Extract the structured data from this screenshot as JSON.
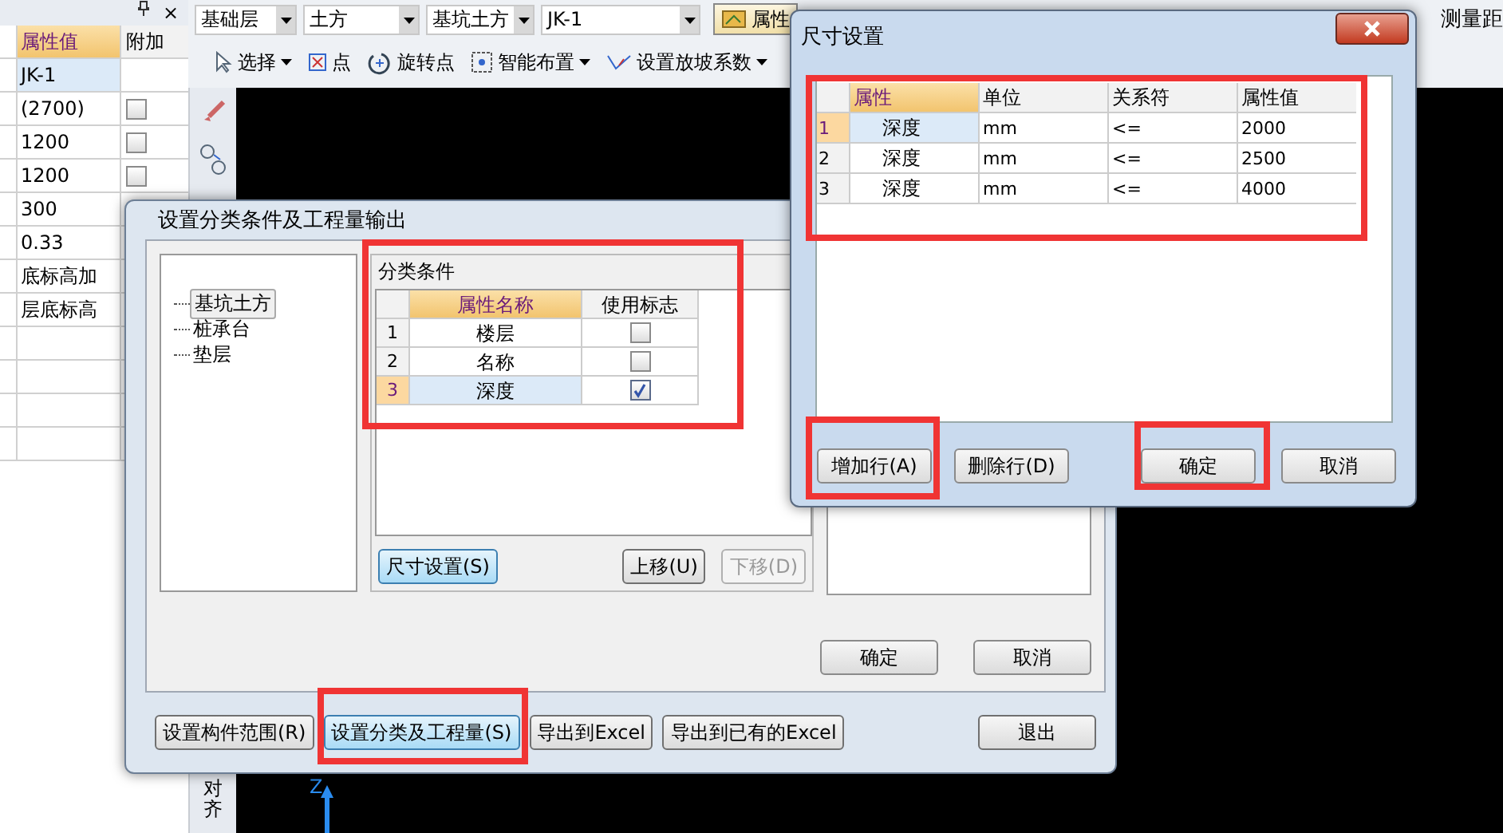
{
  "toolbar_top": {
    "dropdowns": [
      "基础层",
      "土方",
      "基坑土方",
      "JK-1"
    ],
    "attr_button": {
      "label": "属性",
      "selected": true
    },
    "right_label": "测量距"
  },
  "toolbar_second": [
    {
      "label": "选择",
      "kind": "select",
      "dropdown": true
    },
    {
      "label": "点",
      "kind": "point",
      "dropdown": false
    },
    {
      "label": "旋转点",
      "kind": "rotate",
      "dropdown": false
    },
    {
      "label": "智能布置",
      "kind": "smart",
      "dropdown": true
    },
    {
      "label": "设置放坡系数",
      "kind": "slope",
      "dropdown": true
    }
  ],
  "property_panel": {
    "close": "×",
    "columns": [
      "属性值",
      "附加"
    ],
    "rows": [
      {
        "value": "JK-1",
        "kind": "text",
        "selected": true
      },
      {
        "value": "(2700)",
        "kind": "checkbox",
        "checked": false,
        "selected": false
      },
      {
        "value": "1200",
        "kind": "checkbox",
        "checked": false,
        "selected": false
      },
      {
        "value": "1200",
        "kind": "checkbox",
        "checked": false,
        "selected": false
      },
      {
        "value": "300",
        "kind": "text",
        "selected": false
      },
      {
        "value": "0.33",
        "kind": "text",
        "selected": false
      },
      {
        "value": "底标高加",
        "kind": "text",
        "selected": false
      },
      {
        "value": "层底标高",
        "kind": "text",
        "selected": false
      }
    ]
  },
  "side_toolbar": {
    "label": "对齐"
  },
  "canvas": {
    "axis_label": "Z"
  },
  "classify_dialog": {
    "title": "设置分类条件及工程量输出",
    "tree": [
      {
        "label": "基坑土方",
        "selected": true
      },
      {
        "label": "桩承台",
        "selected": false
      },
      {
        "label": "垫层",
        "selected": false
      }
    ],
    "group_title": "分类条件",
    "table": {
      "columns": [
        "属性名称",
        "使用标志"
      ],
      "rows": [
        {
          "index": "1",
          "name": "楼层",
          "checked": false,
          "selected": false
        },
        {
          "index": "2",
          "name": "名称",
          "checked": false,
          "selected": false
        },
        {
          "index": "3",
          "name": "深度",
          "checked": true,
          "selected": true
        }
      ]
    },
    "group_buttons": [
      {
        "label": "尺寸设置(S)",
        "kind": "focused"
      },
      {
        "label": "上移(U)",
        "kind": "normal"
      },
      {
        "label": "下移(D)",
        "kind": "disabled"
      }
    ],
    "inner_buttons": [
      {
        "label": "确定"
      },
      {
        "label": "取消"
      }
    ],
    "footer_buttons": [
      {
        "label": "设置构件范围(R)",
        "kind": "normal"
      },
      {
        "label": "设置分类及工程量(S)",
        "kind": "focused"
      },
      {
        "label": "导出到Excel",
        "kind": "normal"
      },
      {
        "label": "导出到已有的Excel",
        "kind": "normal"
      },
      {
        "label": "退出",
        "kind": "normal"
      }
    ]
  },
  "size_dialog": {
    "title": "尺寸设置",
    "columns": [
      "属性",
      "单位",
      "关系符",
      "属性值"
    ],
    "rows": [
      {
        "index": "1",
        "attribute": "深度",
        "unit": "mm",
        "relation": "<=",
        "value": "2000",
        "selected": true
      },
      {
        "index": "2",
        "attribute": "深度",
        "unit": "mm",
        "relation": "<=",
        "value": "2500",
        "selected": false
      },
      {
        "index": "3",
        "attribute": "深度",
        "unit": "mm",
        "relation": "<=",
        "value": "4000",
        "selected": false
      }
    ],
    "buttons": [
      {
        "label": "增加行(A)"
      },
      {
        "label": "删除行(D)"
      },
      {
        "label": "确定"
      },
      {
        "label": "取消"
      }
    ]
  }
}
